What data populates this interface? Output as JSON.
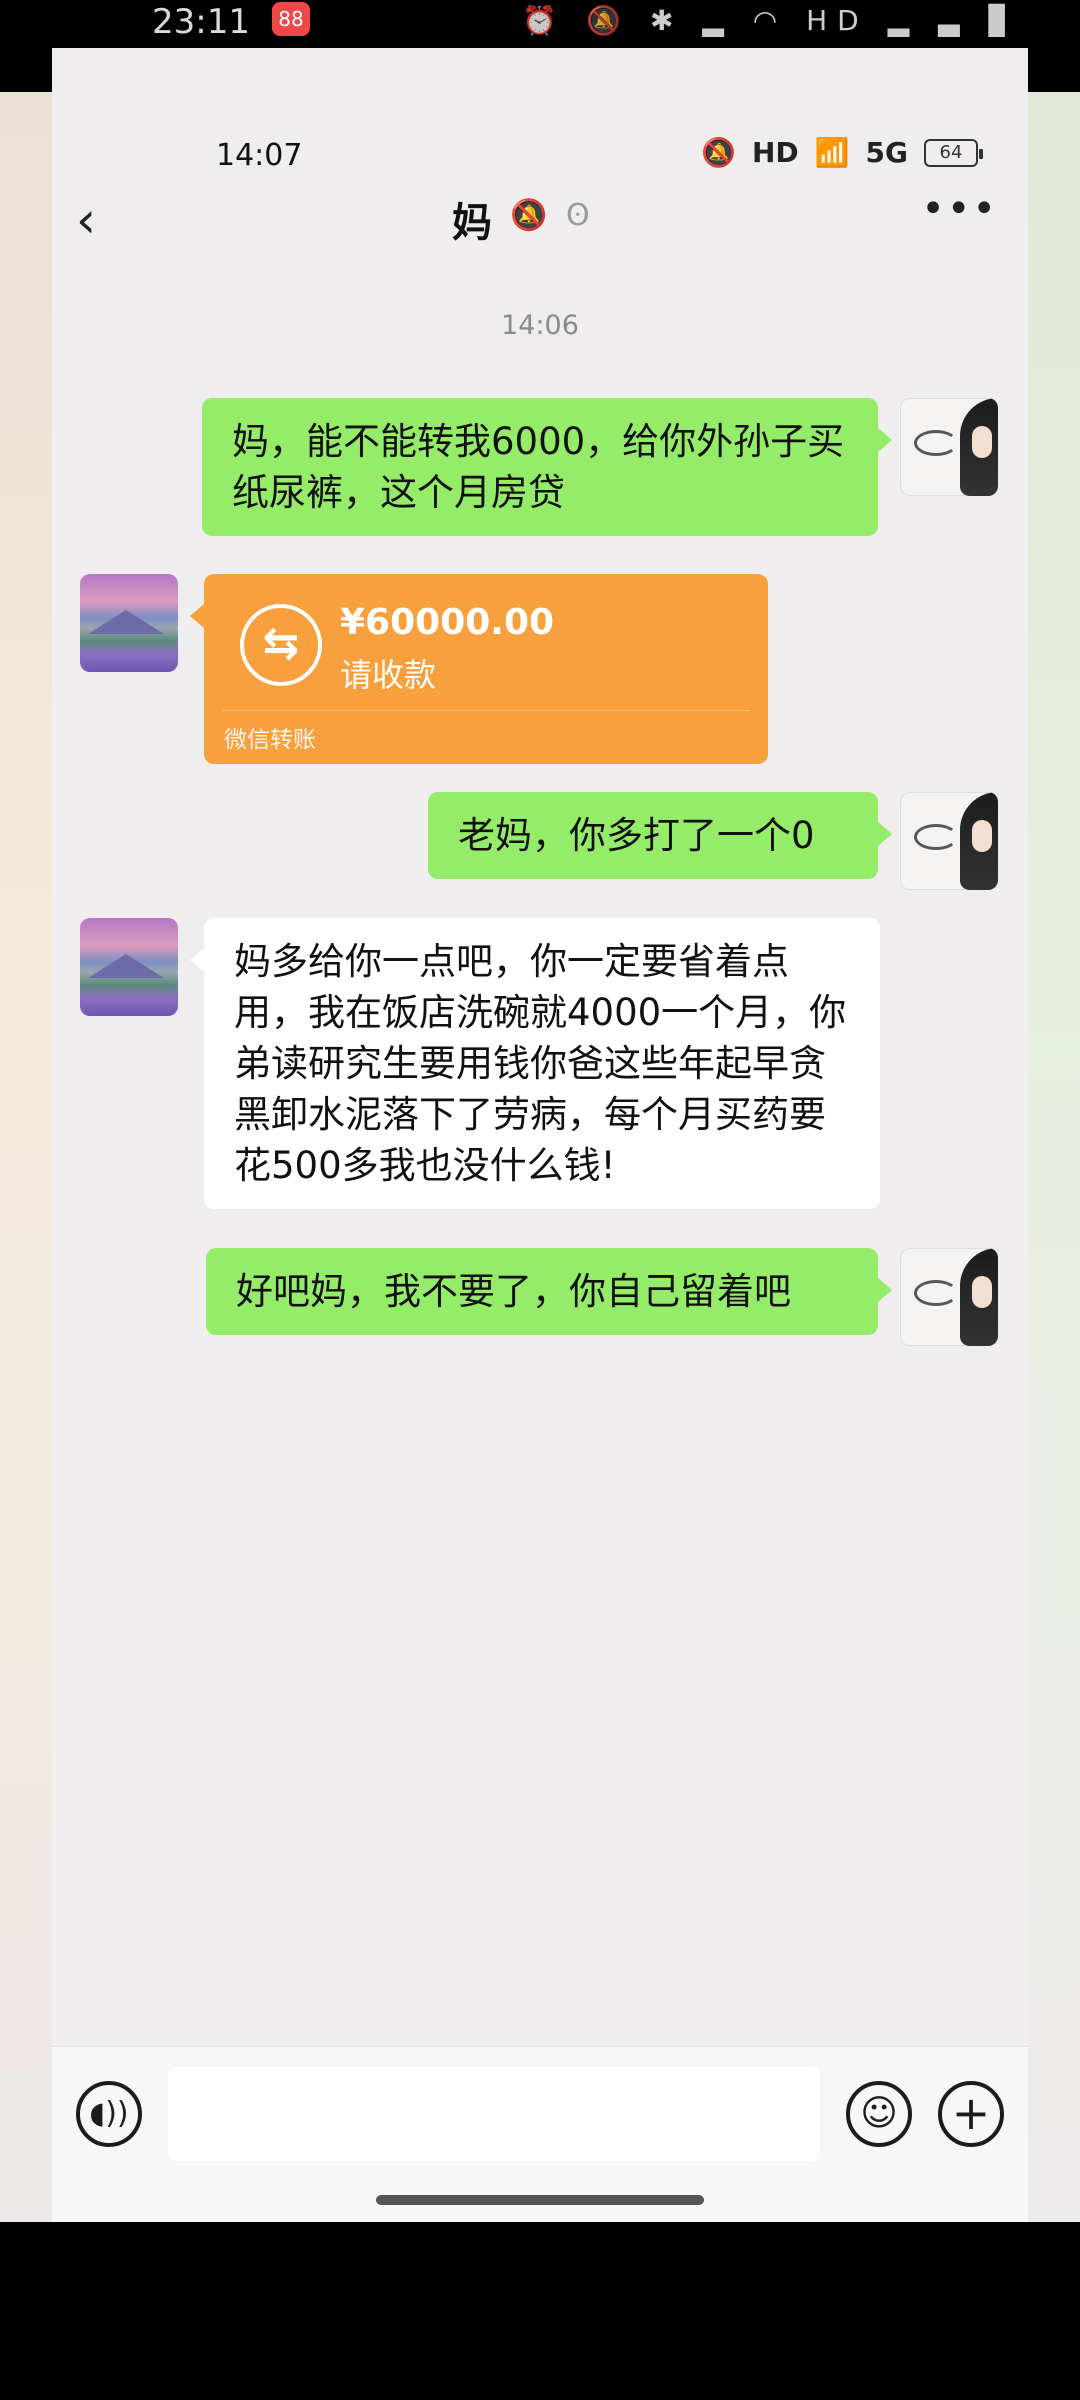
{
  "outer_status": {
    "time": "23:11",
    "app_badge": "88",
    "icons": "⏰ 🔕 ✱ ▂ ◠ HD ▂ ▃ ▊"
  },
  "status_bar": {
    "time": "14:07",
    "icons": [
      "🔕",
      "HD",
      "📶",
      "5G"
    ],
    "battery": "64"
  },
  "chat": {
    "title": "妈",
    "mute_icon": "🔕",
    "ear_icon": "ʘ",
    "back_icon": "‹",
    "more_icon": "•••",
    "timestamp": "14:06"
  },
  "messages": [
    {
      "from": "self",
      "text": "妈，能不能转我6000，给你外孙子买纸尿裤，这个月房贷"
    },
    {
      "from": "mom",
      "type": "transfer",
      "amount": "¥60000.00",
      "status": "请收款",
      "label": "微信转账"
    },
    {
      "from": "self",
      "text": "老妈，你多打了一个0"
    },
    {
      "from": "mom",
      "text": "妈多给你一点吧，你一定要省着点用，我在饭店洗碗就4000一个月，你弟读研究生要用钱你爸这些年起早贪黑卸水泥落下了劳病，每个月买药要花500多我也没什么钱!"
    },
    {
      "from": "self",
      "text": "好吧妈，我不要了，你自己留着吧"
    }
  ],
  "input_bar": {
    "placeholder": "",
    "voice_icon": "◖))",
    "emoji_icon": "☺",
    "plus_icon": "+"
  },
  "colors": {
    "self_bubble": "#95ec69",
    "mom_bubble": "#ffffff",
    "transfer": "#f7a03d",
    "background": "#efedee"
  }
}
